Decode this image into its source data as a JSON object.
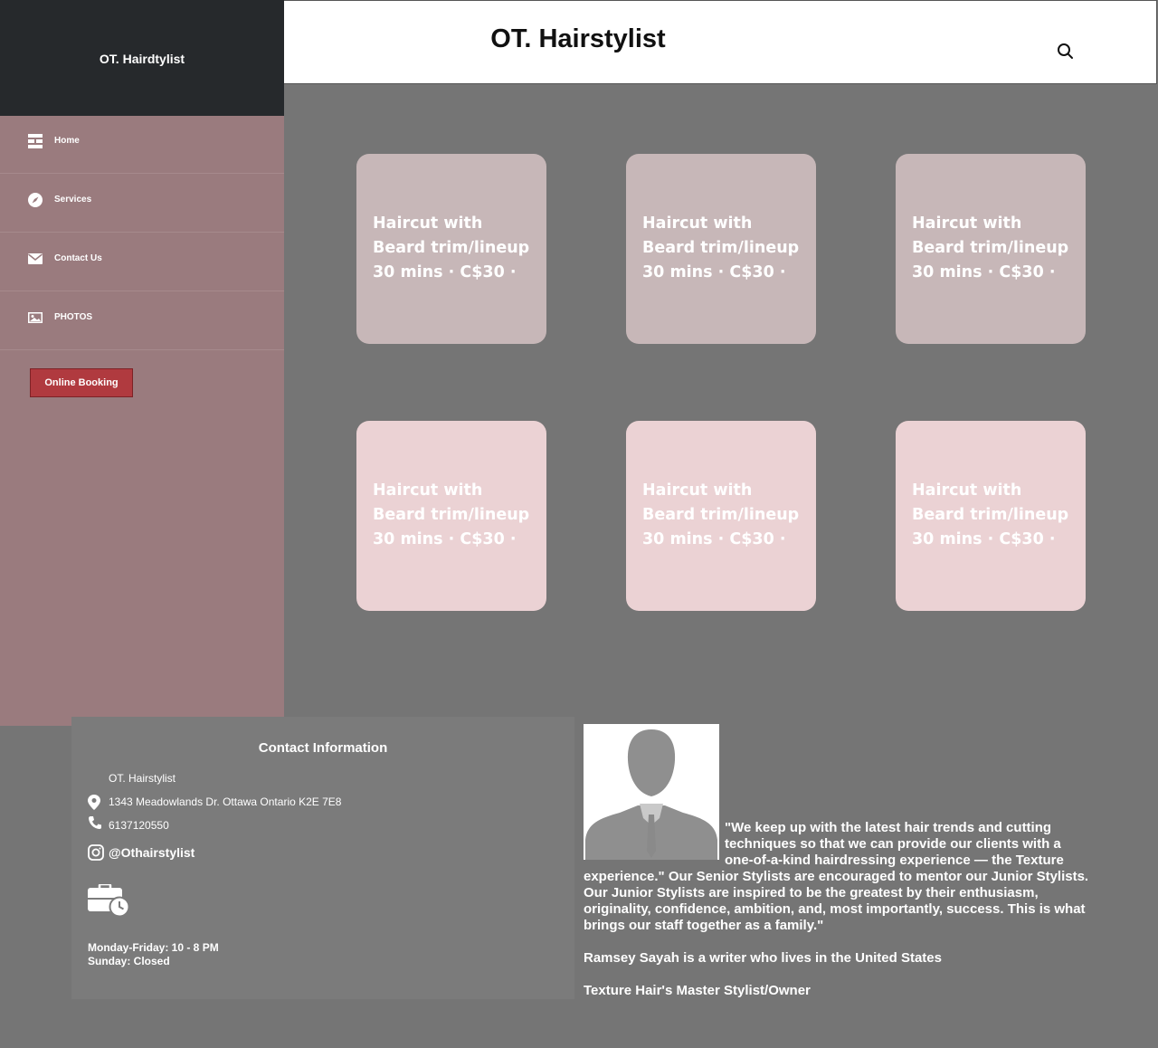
{
  "header": {
    "title": "OT. Hairstylist",
    "search_icon": "search-icon"
  },
  "sidebar": {
    "brand": "OT. Hairdtylist",
    "items": [
      {
        "label": "Home",
        "icon": "dashboard-icon"
      },
      {
        "label": "Services",
        "icon": "compass-icon"
      },
      {
        "label": "Contact Us",
        "icon": "mail-icon"
      },
      {
        "label": "PHOTOS",
        "icon": "image-icon"
      }
    ],
    "booking_label": "Online Booking"
  },
  "cards": [
    {
      "line1": "Haircut with",
      "line2": "Beard trim/lineup",
      "line3": "30 mins · C$30 ·"
    },
    {
      "line1": "Haircut with",
      "line2": "Beard trim/lineup",
      "line3": "30 mins · C$30 ·"
    },
    {
      "line1": "Haircut with",
      "line2": "Beard trim/lineup",
      "line3": "30 mins · C$30 ·"
    },
    {
      "line1": "Haircut with",
      "line2": "Beard trim/lineup",
      "line3": "30 mins · C$30 ·"
    },
    {
      "line1": "Haircut with",
      "line2": "Beard trim/lineup",
      "line3": "30 mins · C$30 ·"
    },
    {
      "line1": "Haircut with",
      "line2": "Beard trim/lineup",
      "line3": "30 mins · C$30 ·"
    }
  ],
  "contact": {
    "title": "Contact Information",
    "name": "OT. Hairstylist",
    "address": "1343 Meadowlands Dr. Ottawa Ontario K2E 7E8",
    "phone": "6137120550",
    "instagram": "@Othairstylist",
    "hours_weekday": "Monday-Friday: 10 - 8 PM",
    "hours_sunday": "Sunday: Closed"
  },
  "about": {
    "quote": "\"We keep up with the latest hair trends and cutting techniques so that we can provide our clients with a one-of-a-kind hairdressing experience — the Texture experience.\" Our Senior Stylists are encouraged to mentor our Junior Stylists. Our Junior Stylists are inspired to be the greatest by their enthusiasm, originality, confidence, ambition, and, most importantly, success. This is what brings our staff together as a family.\"",
    "author": "Ramsey Sayah is a writer who lives in the United States",
    "role": "Texture Hair's Master Stylist/Owner"
  },
  "colors": {
    "background": "#757575",
    "sidebar_top": "#26292c",
    "sidebar": "#9a7b7e",
    "booking": "#b03a3f",
    "card_dark": "#c7b7b8",
    "card_light": "#ebd2d4"
  }
}
